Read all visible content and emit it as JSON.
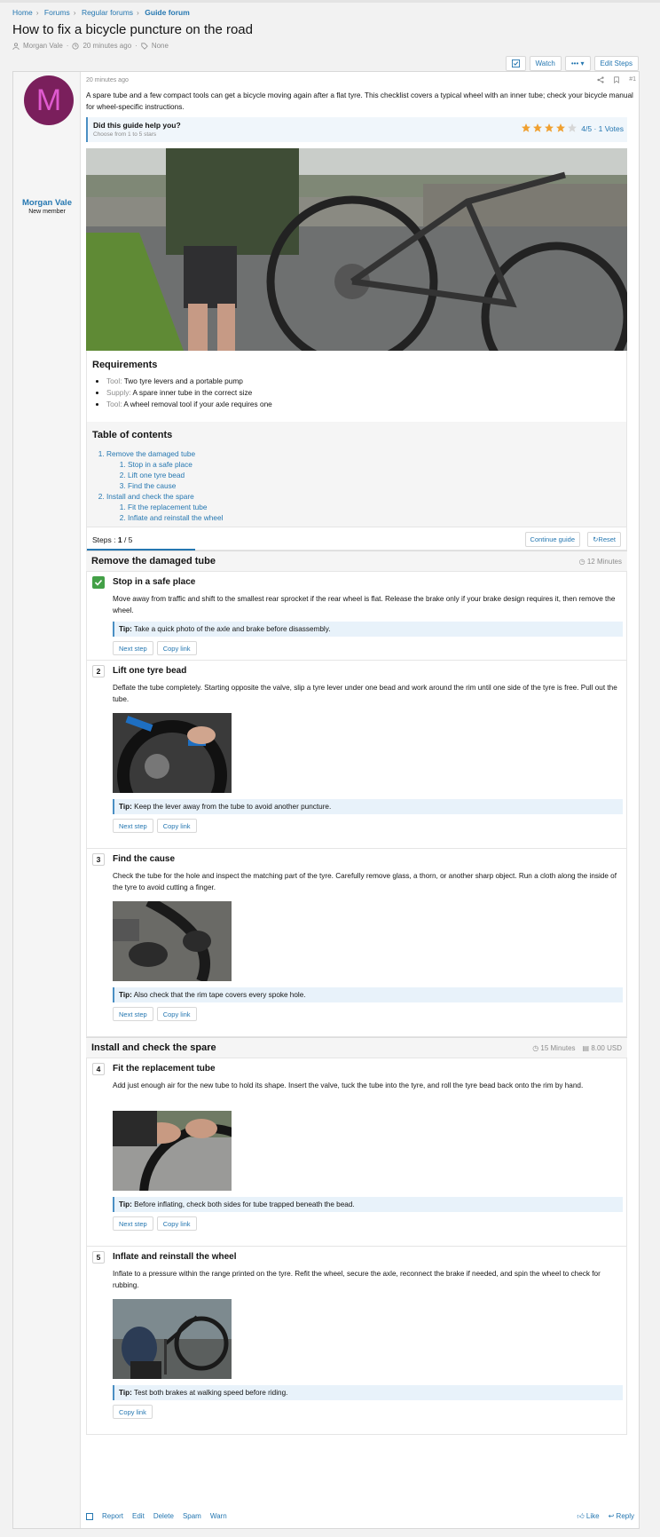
{
  "breadcrumb": [
    "Home",
    "Forums",
    "Regular forums",
    "Guide forum"
  ],
  "thread": {
    "title": "How to fix a bicycle puncture on the road",
    "author": "Morgan Vale",
    "time": "20 minutes ago",
    "tags": "None"
  },
  "actions": {
    "watch": "Watch",
    "more": "•••",
    "edit_steps": "Edit Steps"
  },
  "user": {
    "initial": "M",
    "name": "Morgan Vale",
    "title": "New member"
  },
  "post": {
    "time": "20 minutes ago",
    "number": "#1",
    "intro": "A spare tube and a few compact tools can get a bicycle moving again after a flat tyre. This checklist covers a typical wheel with an inner tube; check your bicycle manual for wheel-specific instructions."
  },
  "rating": {
    "question": "Did this guide help you?",
    "hint": "Choose from 1 to 5 stars",
    "score_text": "4/5 · 1 Votes",
    "value": 4,
    "max": 5,
    "star_color": "#f0a030"
  },
  "requirements": {
    "heading": "Requirements",
    "items": [
      {
        "kind": "Tool:",
        "text": "Two tyre levers and a portable pump"
      },
      {
        "kind": "Supply:",
        "text": "A spare inner tube in the correct size"
      },
      {
        "kind": "Tool:",
        "text": "A wheel removal tool if your axle requires one"
      }
    ]
  },
  "toc": {
    "heading": "Table of contents",
    "groups": [
      {
        "label": "Remove the damaged tube",
        "items": [
          "Stop in a safe place",
          "Lift one tyre bead",
          "Find the cause"
        ]
      },
      {
        "label": "Install and check the spare",
        "items": [
          "Fit the replacement tube",
          "Inflate and reinstall the wheel"
        ]
      }
    ]
  },
  "steps_bar": {
    "label": "Steps :",
    "current": "1",
    "total": "/ 5",
    "progress": 0.2,
    "continue": "Continue guide",
    "reset": "Reset"
  },
  "groups": [
    {
      "heading": "Remove the damaged tube",
      "time": "12 Minutes"
    },
    {
      "heading": "Install and check the spare",
      "time": "15 Minutes",
      "cost": "8.00 USD"
    }
  ],
  "steps": [
    {
      "num": "1",
      "title": "Stop in a safe place",
      "desc": "Move away from traffic and shift to the smallest rear sprocket if the rear wheel is flat. Release the brake only if your brake design requires it, then remove the wheel.",
      "tip_label": "Tip:",
      "tip": "Take a quick photo of the axle and brake before disassembly.",
      "next": "Next step",
      "copy": "Copy link",
      "completed": true
    },
    {
      "num": "2",
      "title": "Lift one tyre bead",
      "desc": "Deflate the tube completely. Starting opposite the valve, slip a tyre lever under one bead and work around the rim until one side of the tyre is free. Pull out the tube.",
      "tip_label": "Tip:",
      "tip": "Keep the lever away from the tube to avoid another puncture.",
      "next": "Next step",
      "copy": "Copy link"
    },
    {
      "num": "3",
      "title": "Find the cause",
      "desc": "Check the tube for the hole and inspect the matching part of the tyre. Carefully remove glass, a thorn, or another sharp object. Run a cloth along the inside of the tyre to avoid cutting a finger.",
      "tip_label": "Tip:",
      "tip": "Also check that the rim tape covers every spoke hole.",
      "next": "Next step",
      "copy": "Copy link"
    },
    {
      "num": "4",
      "title": "Fit the replacement tube",
      "desc": "Add just enough air for the new tube to hold its shape. Insert the valve, tuck the tube into the tyre, and roll the tyre bead back onto the rim by hand.",
      "tip_label": "Tip:",
      "tip": "Before inflating, check both sides for tube trapped beneath the bead.",
      "next": "Next step",
      "copy": "Copy link"
    },
    {
      "num": "5",
      "title": "Inflate and reinstall the wheel",
      "desc": "Inflate to a pressure within the range printed on the tyre. Refit the wheel, secure the axle, reconnect the brake if needed, and spin the wheel to check for rubbing.",
      "tip_label": "Tip:",
      "tip": "Test both brakes at walking speed before riding.",
      "copy": "Copy link"
    }
  ],
  "footer": {
    "report": "Report",
    "edit": "Edit",
    "delete": "Delete",
    "spam": "Spam",
    "warn": "Warn",
    "like": "Like",
    "reply": "Reply"
  }
}
